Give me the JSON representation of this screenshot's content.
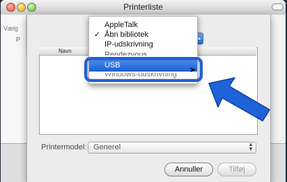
{
  "window": {
    "title": "Printerliste"
  },
  "background": {
    "left_label": "Vælg",
    "left_col": "P"
  },
  "menu": {
    "items": [
      {
        "label": "AppleTalk",
        "checked": false
      },
      {
        "label": "Åbn bibliotek",
        "checked": true
      },
      {
        "label": "IP-udskrivning",
        "checked": false
      },
      {
        "label": "Rendezvous",
        "checked": false
      },
      {
        "label": "USB",
        "checked": false,
        "selected": true
      },
      {
        "label": "Windows-udskrivning",
        "checked": false
      }
    ],
    "check_glyph": "✓"
  },
  "list": {
    "column_name": "Navn"
  },
  "printer_model": {
    "label": "Printermodel:",
    "value": "Generel"
  },
  "buttons": {
    "cancel": "Annuller",
    "add": "Tilføj"
  },
  "colors": {
    "highlight": "#1d5fd8",
    "selected_item": "#2d6fe0"
  }
}
